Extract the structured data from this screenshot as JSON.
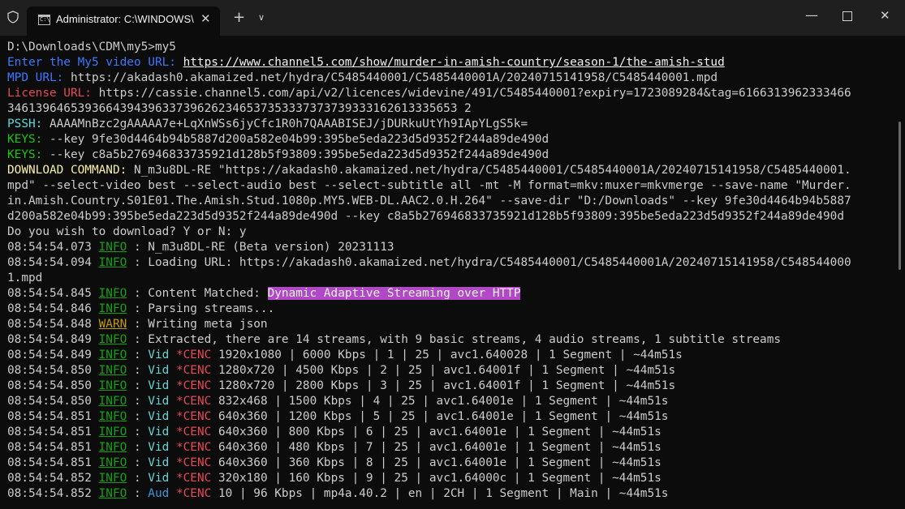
{
  "window": {
    "tab_title": "Administrator: C:\\WINDOWS\\",
    "tab_icon_text": "C:\\",
    "close_tab_glyph": "✕",
    "new_tab_glyph": "+",
    "dropdown_glyph": "∨",
    "minimize_glyph": "—",
    "close_glyph": "✕"
  },
  "colors": {
    "terminal_bg": "#0c0c0c",
    "text": "#cccccc",
    "blue_label": "#3b78ff",
    "red_label": "#e74856",
    "cyan_label": "#61d6d6",
    "green_label": "#16c60c",
    "yellow_label": "#f9f1a5",
    "info": "#13a10e",
    "warn": "#c19c00",
    "highlight": "#b148c6"
  },
  "lines": [
    [
      {
        "t": "D:\\Downloads\\CDM\\my5>my5"
      }
    ],
    [
      {
        "t": "Enter the My5 video URL:",
        "c": "lbl-blue"
      },
      {
        "t": " "
      },
      {
        "t": "https://www.channel5.com/show/murder-in-amish-country/season-1/the-amish-stud",
        "c": "url"
      }
    ],
    [
      {
        "t": "MPD URL:",
        "c": "lbl-blue"
      },
      {
        "t": " https://akadash0.akamaized.net/hydra/C5485440001/C5485440001A/20240715141958/C5485440001.mpd"
      }
    ],
    [
      {
        "t": "License URL:",
        "c": "lbl-red"
      },
      {
        "t": " https://cassie.channel5.com/api/v2/licences/widevine/491/C5485440001?expiry=1723089284&tag=6166313962333466"
      }
    ],
    [
      {
        "t": "3461396465393664394396337396262346537353337373739333162613335653 2"
      }
    ],
    [
      {
        "t": "PSSH:",
        "c": "lbl-cyan"
      },
      {
        "t": " AAAAMnBzc2gAAAAA7e+LqXnWSs6jyCfc1R0h7QAAABISEJ/jDURkuUtYh9IApYLgS5k="
      }
    ],
    [
      {
        "t": "KEYS:",
        "c": "lbl-green"
      },
      {
        "t": " --key 9fe30d4464b94b5887d200a582e04b99:395be5eda223d5d9352f244a89de490d"
      }
    ],
    [
      {
        "t": "KEYS:",
        "c": "lbl-green"
      },
      {
        "t": " --key c8a5b276946833735921d128b5f93809:395be5eda223d5d9352f244a89de490d"
      }
    ],
    [
      {
        "t": "DOWNLOAD COMMAND:",
        "c": "lbl-yellow"
      },
      {
        "t": " N_m3u8DL-RE \"https://akadash0.akamaized.net/hydra/C5485440001/C5485440001A/20240715141958/C5485440001."
      }
    ],
    [
      {
        "t": "mpd\" --select-video best --select-audio best --select-subtitle all -mt -M format=mkv:muxer=mkvmerge --save-name \"Murder."
      }
    ],
    [
      {
        "t": "in.Amish.Country.S01E01.The.Amish.Stud.1080p.MY5.WEB-DL.AAC2.0.H.264\" --save-dir \"D:/Downloads\" --key 9fe30d4464b94b5887"
      }
    ],
    [
      {
        "t": "d200a582e04b99:395be5eda223d5d9352f244a89de490d --key c8a5b276946833735921d128b5f93809:395be5eda223d5d9352f244a89de490d"
      }
    ],
    [
      {
        "t": "Do you wish to download? Y or N: y"
      }
    ],
    [
      {
        "t": "08:54:54.073 "
      },
      {
        "t": "INFO",
        "c": "lvl-info"
      },
      {
        "t": " : N_m3u8DL-RE (Beta version) 20231113"
      }
    ],
    [
      {
        "t": "08:54:54.094 "
      },
      {
        "t": "INFO",
        "c": "lvl-info"
      },
      {
        "t": " : Loading URL: https://akadash0.akamaized.net/hydra/C5485440001/C5485440001A/20240715141958/C548544000"
      }
    ],
    [
      {
        "t": "1.mpd"
      }
    ],
    [
      {
        "t": "08:54:54.845 "
      },
      {
        "t": "INFO",
        "c": "lvl-info"
      },
      {
        "t": " : Content Matched: "
      },
      {
        "t": "Dynamic Adaptive Streaming over HTTP",
        "c": "hl-magenta"
      }
    ],
    [
      {
        "t": "08:54:54.846 "
      },
      {
        "t": "INFO",
        "c": "lvl-info"
      },
      {
        "t": " : Parsing streams..."
      }
    ],
    [
      {
        "t": "08:54:54.848 "
      },
      {
        "t": "WARN",
        "c": "lvl-warn"
      },
      {
        "t": " : Writing meta json"
      }
    ],
    [
      {
        "t": "08:54:54.849 "
      },
      {
        "t": "INFO",
        "c": "lvl-info"
      },
      {
        "t": " : Extracted, there are 14 streams, with 9 basic streams, 4 audio streams, 1 subtitle streams"
      }
    ],
    [
      {
        "t": "08:54:54.849 "
      },
      {
        "t": "INFO",
        "c": "lvl-info"
      },
      {
        "t": " : "
      },
      {
        "t": "Vid",
        "c": "tk-vid"
      },
      {
        "t": " "
      },
      {
        "t": "*CENC",
        "c": "tk-cenc"
      },
      {
        "t": " 1920x1080 | 6000 Kbps | 1 | 25 | avc1.640028 | 1 Segment | ~44m51s"
      }
    ],
    [
      {
        "t": "08:54:54.850 "
      },
      {
        "t": "INFO",
        "c": "lvl-info"
      },
      {
        "t": " : "
      },
      {
        "t": "Vid",
        "c": "tk-vid"
      },
      {
        "t": " "
      },
      {
        "t": "*CENC",
        "c": "tk-cenc"
      },
      {
        "t": " 1280x720 | 4500 Kbps | 2 | 25 | avc1.64001f | 1 Segment | ~44m51s"
      }
    ],
    [
      {
        "t": "08:54:54.850 "
      },
      {
        "t": "INFO",
        "c": "lvl-info"
      },
      {
        "t": " : "
      },
      {
        "t": "Vid",
        "c": "tk-vid"
      },
      {
        "t": " "
      },
      {
        "t": "*CENC",
        "c": "tk-cenc"
      },
      {
        "t": " 1280x720 | 2800 Kbps | 3 | 25 | avc1.64001f | 1 Segment | ~44m51s"
      }
    ],
    [
      {
        "t": "08:54:54.850 "
      },
      {
        "t": "INFO",
        "c": "lvl-info"
      },
      {
        "t": " : "
      },
      {
        "t": "Vid",
        "c": "tk-vid"
      },
      {
        "t": " "
      },
      {
        "t": "*CENC",
        "c": "tk-cenc"
      },
      {
        "t": " 832x468 | 1500 Kbps | 4 | 25 | avc1.64001e | 1 Segment | ~44m51s"
      }
    ],
    [
      {
        "t": "08:54:54.851 "
      },
      {
        "t": "INFO",
        "c": "lvl-info"
      },
      {
        "t": " : "
      },
      {
        "t": "Vid",
        "c": "tk-vid"
      },
      {
        "t": " "
      },
      {
        "t": "*CENC",
        "c": "tk-cenc"
      },
      {
        "t": " 640x360 | 1200 Kbps | 5 | 25 | avc1.64001e | 1 Segment | ~44m51s"
      }
    ],
    [
      {
        "t": "08:54:54.851 "
      },
      {
        "t": "INFO",
        "c": "lvl-info"
      },
      {
        "t": " : "
      },
      {
        "t": "Vid",
        "c": "tk-vid"
      },
      {
        "t": " "
      },
      {
        "t": "*CENC",
        "c": "tk-cenc"
      },
      {
        "t": " 640x360 | 800 Kbps | 6 | 25 | avc1.64001e | 1 Segment | ~44m51s"
      }
    ],
    [
      {
        "t": "08:54:54.851 "
      },
      {
        "t": "INFO",
        "c": "lvl-info"
      },
      {
        "t": " : "
      },
      {
        "t": "Vid",
        "c": "tk-vid"
      },
      {
        "t": " "
      },
      {
        "t": "*CENC",
        "c": "tk-cenc"
      },
      {
        "t": " 640x360 | 480 Kbps | 7 | 25 | avc1.64001e | 1 Segment | ~44m51s"
      }
    ],
    [
      {
        "t": "08:54:54.851 "
      },
      {
        "t": "INFO",
        "c": "lvl-info"
      },
      {
        "t": " : "
      },
      {
        "t": "Vid",
        "c": "tk-vid"
      },
      {
        "t": " "
      },
      {
        "t": "*CENC",
        "c": "tk-cenc"
      },
      {
        "t": " 640x360 | 360 Kbps | 8 | 25 | avc1.64001e | 1 Segment | ~44m51s"
      }
    ],
    [
      {
        "t": "08:54:54.852 "
      },
      {
        "t": "INFO",
        "c": "lvl-info"
      },
      {
        "t": " : "
      },
      {
        "t": "Vid",
        "c": "tk-vid"
      },
      {
        "t": " "
      },
      {
        "t": "*CENC",
        "c": "tk-cenc"
      },
      {
        "t": " 320x180 | 160 Kbps | 9 | 25 | avc1.64000c | 1 Segment | ~44m51s"
      }
    ],
    [
      {
        "t": "08:54:54.852 "
      },
      {
        "t": "INFO",
        "c": "lvl-info"
      },
      {
        "t": " : "
      },
      {
        "t": "Aud",
        "c": "tk-aud"
      },
      {
        "t": " "
      },
      {
        "t": "*CENC",
        "c": "tk-cenc"
      },
      {
        "t": " 10 | 96 Kbps | mp4a.40.2 | en | 2CH | 1 Segment | Main | ~44m51s"
      }
    ]
  ]
}
